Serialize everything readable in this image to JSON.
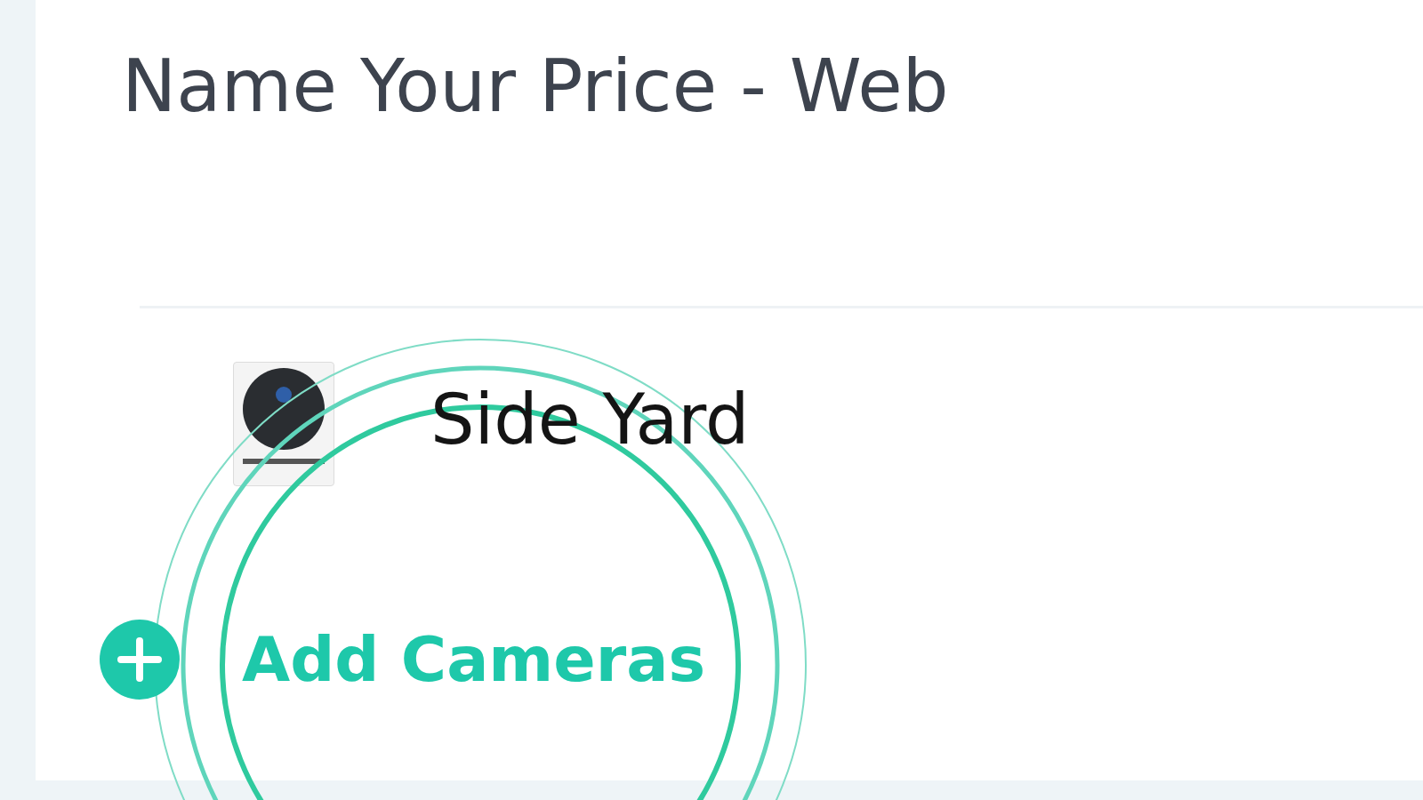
{
  "page": {
    "title": "Name Your Price - Web"
  },
  "cameras": [
    {
      "name": "Side Yard"
    }
  ],
  "add_button": {
    "label": "Add Cameras"
  }
}
